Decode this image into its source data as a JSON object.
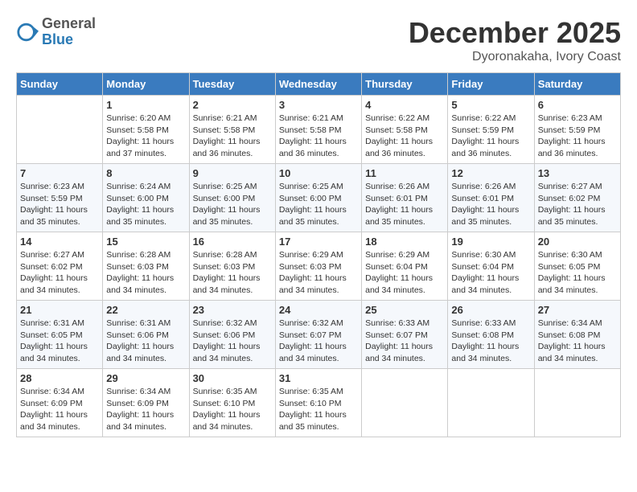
{
  "header": {
    "logo_general": "General",
    "logo_blue": "Blue",
    "month_title": "December 2025",
    "location": "Dyoronakaha, Ivory Coast"
  },
  "days_of_week": [
    "Sunday",
    "Monday",
    "Tuesday",
    "Wednesday",
    "Thursday",
    "Friday",
    "Saturday"
  ],
  "weeks": [
    [
      {
        "day": "",
        "info": ""
      },
      {
        "day": "1",
        "info": "Sunrise: 6:20 AM\nSunset: 5:58 PM\nDaylight: 11 hours and 37 minutes."
      },
      {
        "day": "2",
        "info": "Sunrise: 6:21 AM\nSunset: 5:58 PM\nDaylight: 11 hours and 36 minutes."
      },
      {
        "day": "3",
        "info": "Sunrise: 6:21 AM\nSunset: 5:58 PM\nDaylight: 11 hours and 36 minutes."
      },
      {
        "day": "4",
        "info": "Sunrise: 6:22 AM\nSunset: 5:58 PM\nDaylight: 11 hours and 36 minutes."
      },
      {
        "day": "5",
        "info": "Sunrise: 6:22 AM\nSunset: 5:59 PM\nDaylight: 11 hours and 36 minutes."
      },
      {
        "day": "6",
        "info": "Sunrise: 6:23 AM\nSunset: 5:59 PM\nDaylight: 11 hours and 36 minutes."
      }
    ],
    [
      {
        "day": "7",
        "info": "Sunrise: 6:23 AM\nSunset: 5:59 PM\nDaylight: 11 hours and 35 minutes."
      },
      {
        "day": "8",
        "info": "Sunrise: 6:24 AM\nSunset: 6:00 PM\nDaylight: 11 hours and 35 minutes."
      },
      {
        "day": "9",
        "info": "Sunrise: 6:25 AM\nSunset: 6:00 PM\nDaylight: 11 hours and 35 minutes."
      },
      {
        "day": "10",
        "info": "Sunrise: 6:25 AM\nSunset: 6:00 PM\nDaylight: 11 hours and 35 minutes."
      },
      {
        "day": "11",
        "info": "Sunrise: 6:26 AM\nSunset: 6:01 PM\nDaylight: 11 hours and 35 minutes."
      },
      {
        "day": "12",
        "info": "Sunrise: 6:26 AM\nSunset: 6:01 PM\nDaylight: 11 hours and 35 minutes."
      },
      {
        "day": "13",
        "info": "Sunrise: 6:27 AM\nSunset: 6:02 PM\nDaylight: 11 hours and 35 minutes."
      }
    ],
    [
      {
        "day": "14",
        "info": "Sunrise: 6:27 AM\nSunset: 6:02 PM\nDaylight: 11 hours and 34 minutes."
      },
      {
        "day": "15",
        "info": "Sunrise: 6:28 AM\nSunset: 6:03 PM\nDaylight: 11 hours and 34 minutes."
      },
      {
        "day": "16",
        "info": "Sunrise: 6:28 AM\nSunset: 6:03 PM\nDaylight: 11 hours and 34 minutes."
      },
      {
        "day": "17",
        "info": "Sunrise: 6:29 AM\nSunset: 6:03 PM\nDaylight: 11 hours and 34 minutes."
      },
      {
        "day": "18",
        "info": "Sunrise: 6:29 AM\nSunset: 6:04 PM\nDaylight: 11 hours and 34 minutes."
      },
      {
        "day": "19",
        "info": "Sunrise: 6:30 AM\nSunset: 6:04 PM\nDaylight: 11 hours and 34 minutes."
      },
      {
        "day": "20",
        "info": "Sunrise: 6:30 AM\nSunset: 6:05 PM\nDaylight: 11 hours and 34 minutes."
      }
    ],
    [
      {
        "day": "21",
        "info": "Sunrise: 6:31 AM\nSunset: 6:05 PM\nDaylight: 11 hours and 34 minutes."
      },
      {
        "day": "22",
        "info": "Sunrise: 6:31 AM\nSunset: 6:06 PM\nDaylight: 11 hours and 34 minutes."
      },
      {
        "day": "23",
        "info": "Sunrise: 6:32 AM\nSunset: 6:06 PM\nDaylight: 11 hours and 34 minutes."
      },
      {
        "day": "24",
        "info": "Sunrise: 6:32 AM\nSunset: 6:07 PM\nDaylight: 11 hours and 34 minutes."
      },
      {
        "day": "25",
        "info": "Sunrise: 6:33 AM\nSunset: 6:07 PM\nDaylight: 11 hours and 34 minutes."
      },
      {
        "day": "26",
        "info": "Sunrise: 6:33 AM\nSunset: 6:08 PM\nDaylight: 11 hours and 34 minutes."
      },
      {
        "day": "27",
        "info": "Sunrise: 6:34 AM\nSunset: 6:08 PM\nDaylight: 11 hours and 34 minutes."
      }
    ],
    [
      {
        "day": "28",
        "info": "Sunrise: 6:34 AM\nSunset: 6:09 PM\nDaylight: 11 hours and 34 minutes."
      },
      {
        "day": "29",
        "info": "Sunrise: 6:34 AM\nSunset: 6:09 PM\nDaylight: 11 hours and 34 minutes."
      },
      {
        "day": "30",
        "info": "Sunrise: 6:35 AM\nSunset: 6:10 PM\nDaylight: 11 hours and 34 minutes."
      },
      {
        "day": "31",
        "info": "Sunrise: 6:35 AM\nSunset: 6:10 PM\nDaylight: 11 hours and 35 minutes."
      },
      {
        "day": "",
        "info": ""
      },
      {
        "day": "",
        "info": ""
      },
      {
        "day": "",
        "info": ""
      }
    ]
  ]
}
